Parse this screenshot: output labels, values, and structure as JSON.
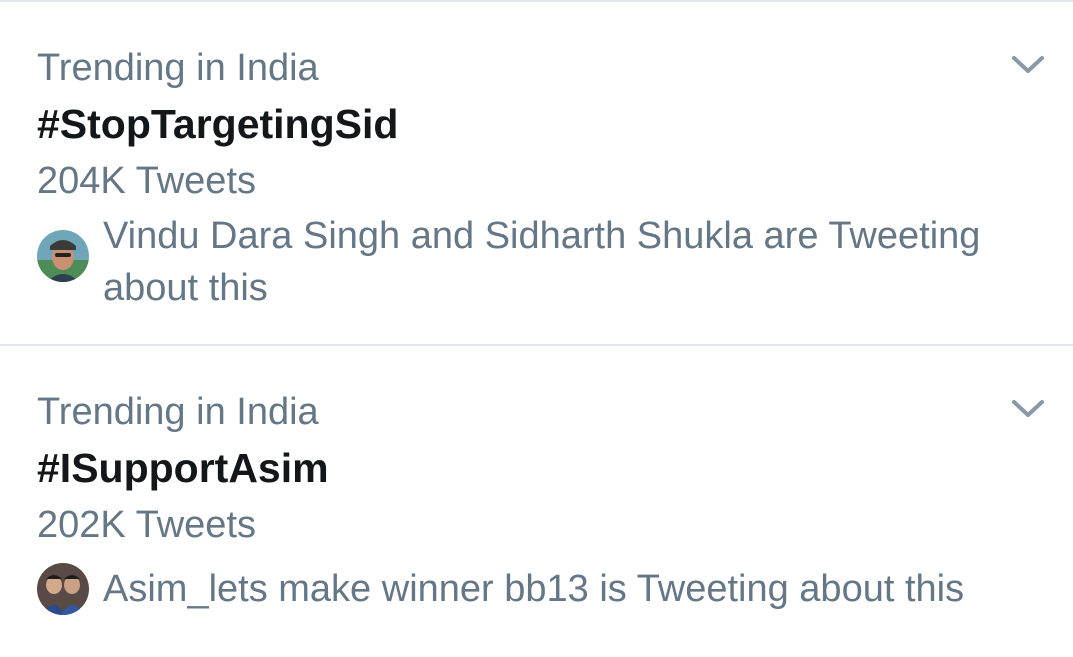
{
  "trends": [
    {
      "context": "Trending in India",
      "name": "#StopTargetingSid",
      "count": "204K Tweets",
      "tweeting": "Vindu Dara Singh and Sidharth Shukla are Tweeting about this",
      "icon": "chevron-down-icon"
    },
    {
      "context": "Trending in India",
      "name": "#ISupportAsim",
      "count": "202K Tweets",
      "tweeting": "Asim_lets make winner bb13 is Tweeting about this",
      "icon": "chevron-down-icon"
    }
  ],
  "colors": {
    "secondary_text": "#657786",
    "primary_text": "#14171a",
    "divider": "#e1e8ed",
    "chevron": "#8899a6"
  }
}
